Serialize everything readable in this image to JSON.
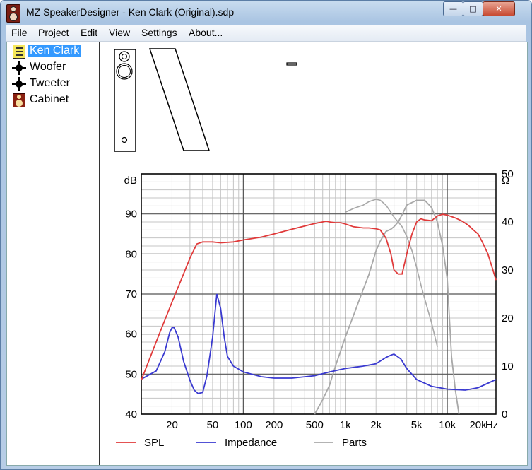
{
  "window": {
    "title": "MZ SpeakerDesigner - Ken Clark (Original).sdp"
  },
  "menu": [
    "File",
    "Project",
    "Edit",
    "View",
    "Settings",
    "About..."
  ],
  "tree": [
    {
      "label": "Ken Clark",
      "icon": "project-icon",
      "selected": true
    },
    {
      "label": "Woofer",
      "icon": "driver-icon"
    },
    {
      "label": "Tweeter",
      "icon": "driver-icon"
    },
    {
      "label": "Cabinet",
      "icon": "cabinet-icon"
    }
  ],
  "colors": {
    "spl": "#e03a3a",
    "impedance": "#3a3ad0",
    "parts": "#a8a8a8",
    "selection": "#3399ff"
  },
  "chart_data": {
    "type": "line",
    "x_scale": "log",
    "xlim": [
      10,
      30000
    ],
    "ylim_left": [
      40,
      100
    ],
    "ylim_right": [
      0,
      50
    ],
    "ylabel_left": "dB",
    "ylabel_right": "Ω",
    "x_ticks": [
      {
        "v": 20,
        "label": "20"
      },
      {
        "v": 50,
        "label": "50"
      },
      {
        "v": 100,
        "label": "100"
      },
      {
        "v": 200,
        "label": "200"
      },
      {
        "v": 500,
        "label": "500"
      },
      {
        "v": 1000,
        "label": "1k"
      },
      {
        "v": 2000,
        "label": "2k"
      },
      {
        "v": 5000,
        "label": "5k"
      },
      {
        "v": 10000,
        "label": "10k"
      },
      {
        "v": 20000,
        "label": "20k"
      }
    ],
    "x_unit": "Hz",
    "y_ticks_left": [
      40,
      50,
      60,
      70,
      80,
      90
    ],
    "y_ticks_right": [
      0,
      10,
      20,
      30,
      40,
      50
    ],
    "grid": true,
    "legend_position": "bottom",
    "series": [
      {
        "name": "SPL",
        "axis": "left",
        "x": [
          10,
          15,
          20,
          25,
          30,
          35,
          40,
          50,
          60,
          80,
          100,
          150,
          200,
          300,
          400,
          500,
          600,
          650,
          700,
          800,
          900,
          1000,
          1200,
          1500,
          1700,
          2000,
          2200,
          2500,
          2800,
          3000,
          3300,
          3600,
          4000,
          4500,
          5000,
          5500,
          6000,
          7000,
          8000,
          9000,
          10000,
          12000,
          14000,
          16000,
          18000,
          20000,
          22000,
          25000,
          28000,
          30000
        ],
        "y": [
          48.5,
          60,
          68,
          74,
          79,
          82.5,
          83,
          83,
          82.8,
          83,
          83.5,
          84.2,
          85,
          86.2,
          87,
          87.6,
          88,
          88.2,
          88,
          87.8,
          87.8,
          87.5,
          86.8,
          86.5,
          86.5,
          86.3,
          86,
          84,
          80,
          76,
          75,
          75,
          80,
          85,
          88,
          88.8,
          88.5,
          88.3,
          89.5,
          89.9,
          89.7,
          89,
          88.2,
          87.2,
          86,
          85,
          83,
          80,
          76,
          73.5
        ]
      },
      {
        "name": "Impedance",
        "axis": "right",
        "x": [
          10,
          14,
          17,
          19,
          20,
          21,
          23,
          26,
          30,
          33,
          36,
          40,
          44,
          50,
          55,
          60,
          65,
          70,
          80,
          100,
          150,
          200,
          300,
          500,
          700,
          1000,
          1500,
          2000,
          2500,
          2800,
          3000,
          3500,
          4000,
          5000,
          7000,
          10000,
          15000,
          20000,
          30000
        ],
        "y": [
          7.3,
          9,
          13,
          17,
          18,
          18,
          16,
          11,
          7,
          5,
          4.3,
          4.5,
          8,
          16,
          25,
          22,
          16,
          12,
          10,
          8.8,
          7.8,
          7.5,
          7.5,
          8,
          8.8,
          9.5,
          10,
          10.5,
          11.8,
          12.3,
          12.5,
          11.5,
          9.5,
          7.2,
          5.8,
          5.2,
          5.0,
          5.5,
          7.2
        ]
      },
      {
        "name": "Parts",
        "axis": "right",
        "x": [
          500,
          600,
          700,
          800,
          1000,
          1200,
          1500,
          1700,
          2000,
          2200,
          2500,
          2800,
          3000,
          3300,
          3600,
          4000,
          5000,
          6000,
          7000,
          8000,
          9000,
          10000,
          11000,
          12000,
          13000
        ],
        "y": [
          0,
          3,
          6,
          10,
          16,
          20.5,
          26,
          29,
          34,
          36,
          38,
          38.5,
          39,
          40,
          41.5,
          43.5,
          44.5,
          44.5,
          43,
          40,
          35,
          28,
          12,
          5,
          0
        ]
      }
    ],
    "parts_overlay": {
      "x": [
        1000,
        1200,
        1500,
        1700,
        2000,
        2200,
        2500,
        2800,
        3000,
        3300,
        3600,
        4000,
        4500,
        5000,
        5500,
        6000,
        7000,
        8000
      ],
      "y": [
        42,
        42.8,
        43.5,
        44.2,
        44.7,
        44.5,
        43.5,
        42,
        41,
        40,
        39,
        37,
        34,
        30.5,
        27,
        24,
        19,
        14
      ]
    }
  }
}
